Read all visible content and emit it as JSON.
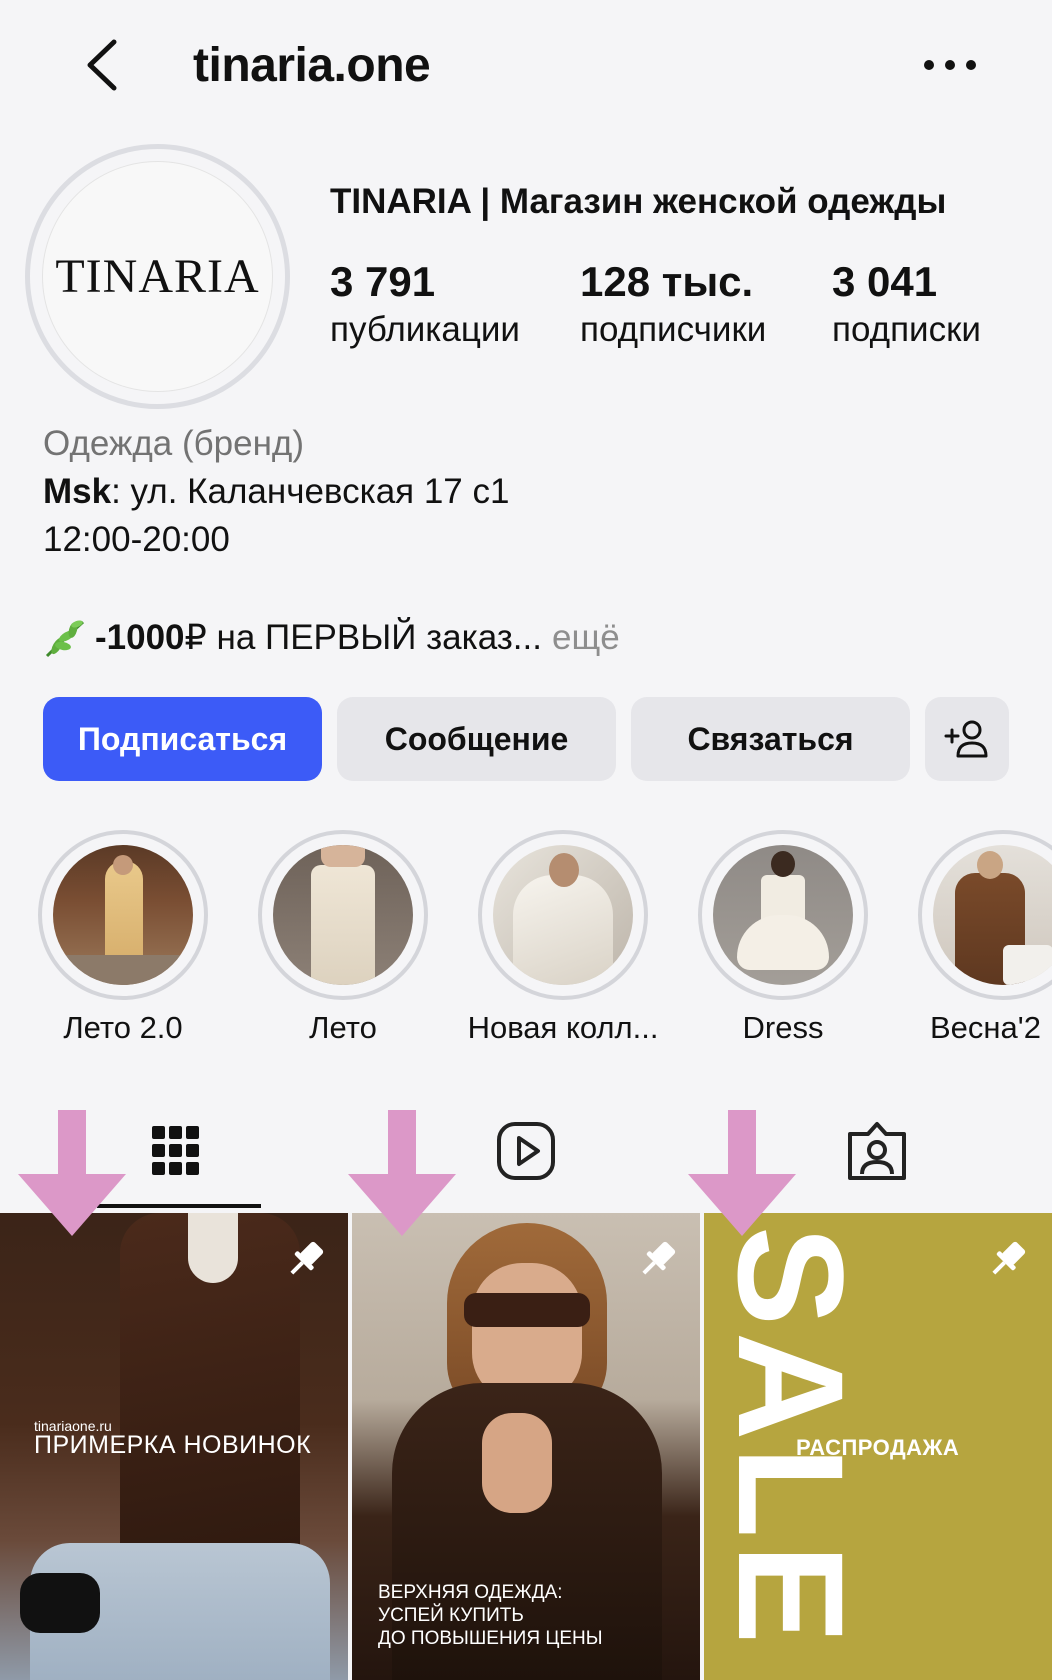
{
  "header": {
    "title": "tinaria.one"
  },
  "profile": {
    "avatar_text": "TINARIA",
    "name": "TINARIA | Магазин женской одежды",
    "stats": [
      {
        "value": "3 791",
        "label": "публикации"
      },
      {
        "value": "128 тыс.",
        "label": "подписчики"
      },
      {
        "value": "3 041",
        "label": "подписки"
      }
    ]
  },
  "bio": {
    "category": "Одежда (бренд)",
    "address_bold": "Msk",
    "address_rest": ": ул. Каланчевская 17 с1",
    "hours": "12:00-20:00",
    "promo_bold": "-1000",
    "promo_rest": "₽ на ПЕРВЫЙ заказ...",
    "more": "ещё"
  },
  "actions": {
    "follow": "Подписаться",
    "message": "Сообщение",
    "contact": "Связаться"
  },
  "highlights": [
    {
      "label": "Лето 2.0"
    },
    {
      "label": "Лето"
    },
    {
      "label": "Новая колл..."
    },
    {
      "label": "Dress"
    },
    {
      "label": "Весна'2"
    }
  ],
  "posts": [
    {
      "small": "tinariaone.ru",
      "caption": "ПРИМЕРКА НОВИНОК"
    },
    {
      "caption_lines": [
        "ВЕРХНЯЯ ОДЕЖДА:",
        "УСПЕЙ КУПИТЬ",
        "ДО ПОВЫШЕНИЯ ЦЕНЫ"
      ]
    },
    {
      "big": "SALE",
      "caption": "РАСПРОДАЖА"
    }
  ],
  "colors": {
    "primary_button": "#3c5bf7",
    "secondary_button": "#e6e6ea",
    "annotation_arrow": "#dc98c8",
    "sale_background": "#b6a53f"
  }
}
